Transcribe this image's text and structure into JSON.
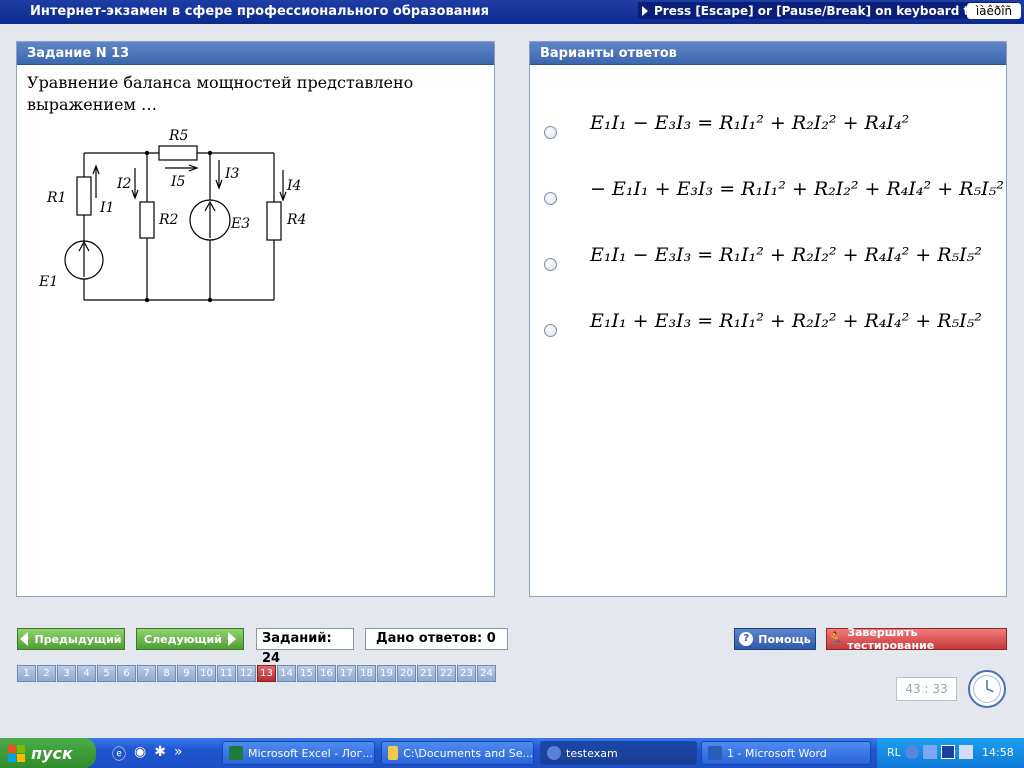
{
  "window": {
    "title": "Интернет-экзамен в сфере профессионального образования",
    "hint": "Press [Escape] or [Pause/Break] on keyboard to stop",
    "lang": "ìàêðîñ"
  },
  "task": {
    "header": "Задание N 13",
    "question": "Уравнение баланса мощностей представлено выражением …"
  },
  "circuit_labels": [
    "R5",
    "R1",
    "I1",
    "I2",
    "R2",
    "I5",
    "I3",
    "E3",
    "I4",
    "R4",
    "E1"
  ],
  "answers_panel": {
    "header": "Варианты ответов"
  },
  "answers": [
    "E₁I₁ − E₃I₃ = R₁I₁² + R₂I₂² + R₄I₄²",
    "− E₁I₁ + E₃I₃ = R₁I₁² + R₂I₂² + R₄I₄² + R₅I₅²",
    "E₁I₁ − E₃I₃ = R₁I₁² + R₂I₂² + R₄I₄² + R₅I₅²",
    "E₁I₁ + E₃I₃ = R₁I₁² + R₂I₂² + R₄I₄² + R₅I₅²"
  ],
  "nav": {
    "prev": "Предыдущий",
    "next": "Следующий",
    "tasks_count": "Заданий: 24",
    "answers_given": "Дано ответов: 0",
    "help": "Помощь",
    "finish": "Завершить тестирование"
  },
  "pages": [
    "1",
    "2",
    "3",
    "4",
    "5",
    "6",
    "7",
    "8",
    "9",
    "10",
    "11",
    "12",
    "13",
    "14",
    "15",
    "16",
    "17",
    "18",
    "19",
    "20",
    "21",
    "22",
    "23",
    "24"
  ],
  "active_page": "13",
  "timer": "43 : 33",
  "taskbar": {
    "start": "пуск",
    "items": [
      "Microsoft Excel - Лог...",
      "C:\\Documents and Se...",
      "testexam",
      "1 - Microsoft Word"
    ],
    "tray_lang": "RL",
    "time": "14:58"
  },
  "colors": {
    "title_bar": "#0b2a8e",
    "panel_header": "#3c66ad",
    "nav_green": "#4f9e32",
    "finish_red": "#c73a3a",
    "active_page": "#b52d2d"
  }
}
